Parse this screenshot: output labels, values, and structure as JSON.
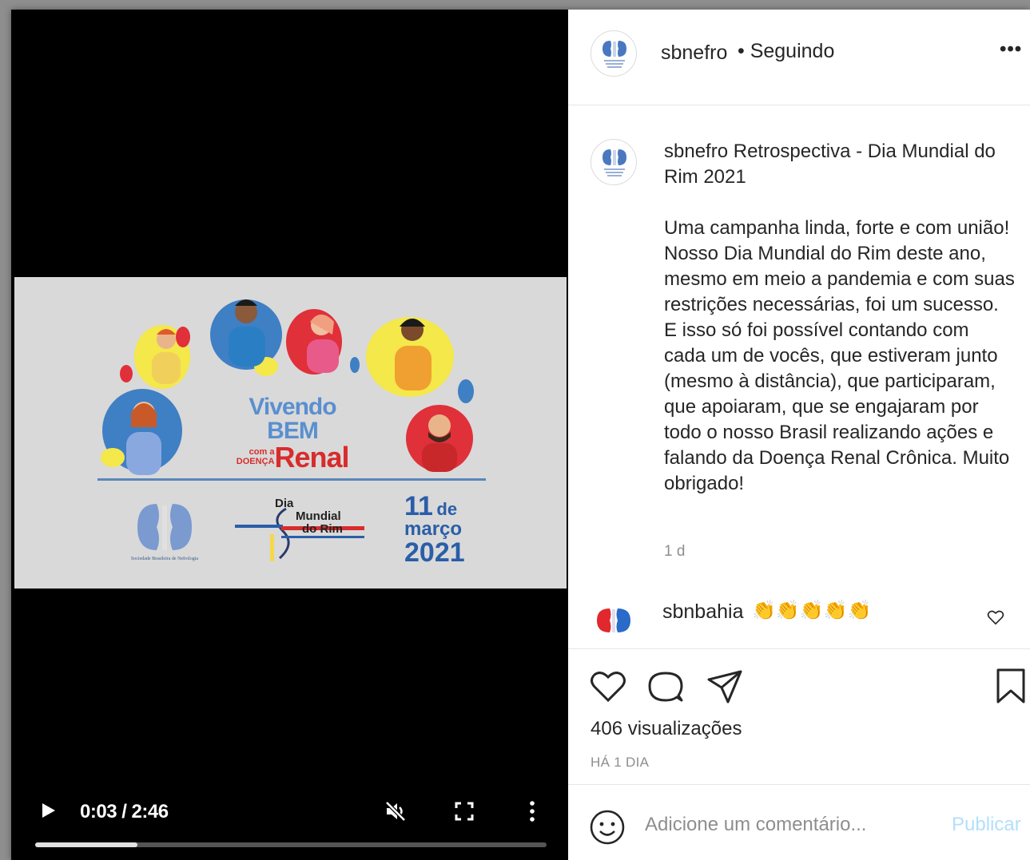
{
  "video": {
    "campaign": {
      "line1": "Vivendo BEM",
      "line2_small": "com a DOENÇA",
      "line2_big": "Renal"
    },
    "logos": {
      "sbn_caption": "Sociedade Brasileira de Nefrologia",
      "dmr_line1": "Dia",
      "dmr_line2": "Mundial",
      "dmr_line3": "do Rim"
    },
    "date": {
      "day": "11",
      "de": "de",
      "month": "março",
      "year": "2021"
    },
    "controls": {
      "time": "0:03 / 2:46",
      "progress_fraction": 0.2
    }
  },
  "post": {
    "header": {
      "username": "sbnefro",
      "follow_status": "• Seguindo",
      "more": "•••"
    },
    "caption": {
      "username": "sbnefro",
      "title": "Retrospectiva - Dia Mundial do Rim 2021",
      "body": "Uma campanha linda, forte e com união! Nosso Dia Mundial do Rim deste ano, mesmo em meio a pandemia e com suas restrições necessárias, foi um sucesso. E isso só foi possível contando com cada um de vocês, que estiveram junto (mesmo à distância), que participaram, que apoiaram, que se engajaram por todo o nosso Brasil realizando ações e falando da Doença Renal Crônica. Muito obrigado!",
      "time": "1 d"
    },
    "comment": {
      "username": "sbnbahia",
      "text": "👏👏👏👏👏"
    },
    "stats": {
      "views": "406 visualizações",
      "date": "HÁ 1 DIA"
    },
    "add_comment": {
      "placeholder": "Adicione um comentário...",
      "publish": "Publicar"
    }
  },
  "colors": {
    "brand_blue": "#2a5ea8",
    "renal_red": "#d82c2c",
    "publish_disabled": "#b2dffc",
    "muted_text": "#8e8e8e"
  },
  "icons": [
    "play-icon",
    "mute-icon",
    "fullscreen-icon",
    "more-vertical-icon",
    "heart-icon",
    "comment-icon",
    "share-icon",
    "bookmark-icon",
    "emoji-icon"
  ]
}
